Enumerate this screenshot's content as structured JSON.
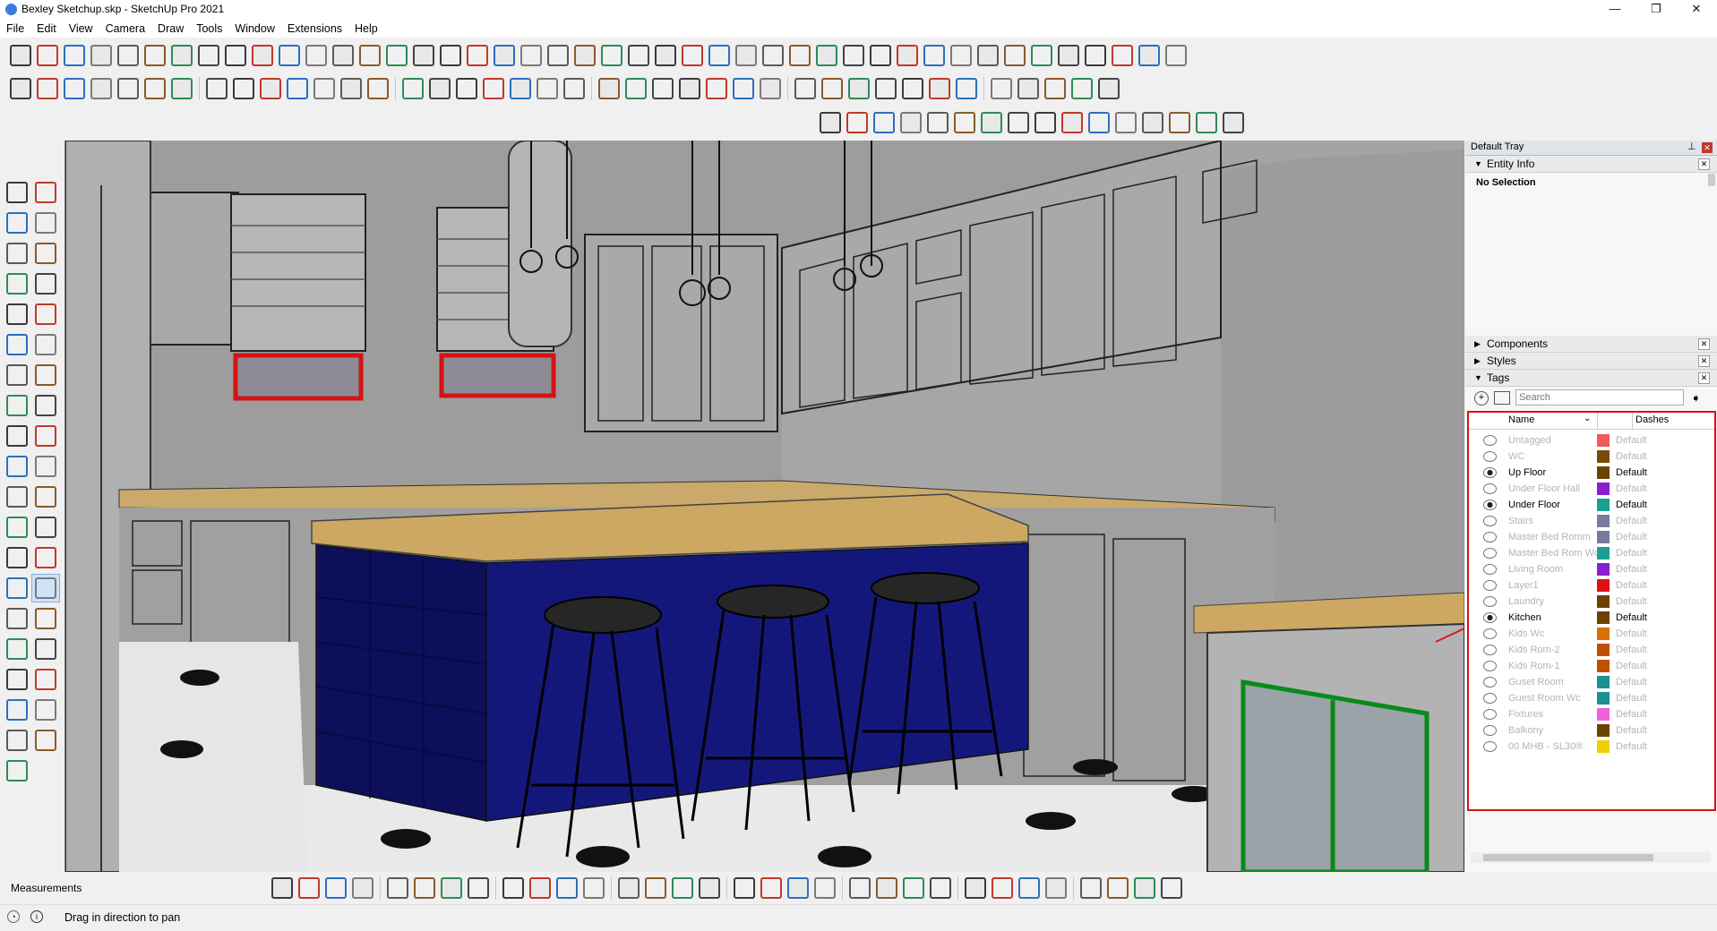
{
  "window": {
    "title": "Bexley Sketchup.skp - SketchUp Pro 2021",
    "controls": [
      "—",
      "❐",
      "✕"
    ]
  },
  "menu": [
    "File",
    "Edit",
    "View",
    "Camera",
    "Draw",
    "Tools",
    "Window",
    "Extensions",
    "Help"
  ],
  "tray": {
    "title": "Default Tray",
    "entity_info": {
      "label": "Entity Info",
      "selection": "No Selection"
    },
    "panels": [
      "Components",
      "Styles",
      "Tags"
    ],
    "tags": {
      "search_placeholder": "Search",
      "col_name": "Name",
      "col_dashes": "Dashes",
      "rows": [
        {
          "name": "Untagged",
          "color": "#f25a5a",
          "dashes": "Default",
          "visible": false
        },
        {
          "name": "WC",
          "color": "#7a4a0a",
          "dashes": "Default",
          "visible": false
        },
        {
          "name": "Up Floor",
          "color": "#6b4300",
          "dashes": "Default",
          "visible": true
        },
        {
          "name": "Under Floor Hall",
          "color": "#8a1fd0",
          "dashes": "Default",
          "visible": false
        },
        {
          "name": "Under Floor",
          "color": "#1aa08e",
          "dashes": "Default",
          "visible": true
        },
        {
          "name": "Stairs",
          "color": "#7a7a99",
          "dashes": "Default",
          "visible": false
        },
        {
          "name": "Master Bed Romm",
          "color": "#7a7a99",
          "dashes": "Default",
          "visible": false
        },
        {
          "name": "Master Bed Rom Wc",
          "color": "#1aa08e",
          "dashes": "Default",
          "visible": false
        },
        {
          "name": "Living Room",
          "color": "#8a1fd0",
          "dashes": "Default",
          "visible": false
        },
        {
          "name": "Layer1",
          "color": "#e01010",
          "dashes": "Default",
          "visible": false
        },
        {
          "name": "Laundry",
          "color": "#6b4300",
          "dashes": "Default",
          "visible": false
        },
        {
          "name": "Kitchen",
          "color": "#6b4300",
          "dashes": "Default",
          "visible": true
        },
        {
          "name": "Kids Wc",
          "color": "#d97000",
          "dashes": "Default",
          "visible": false
        },
        {
          "name": "Kids Rom-2",
          "color": "#c05000",
          "dashes": "Default",
          "visible": false
        },
        {
          "name": "Kids Rom-1",
          "color": "#c05000",
          "dashes": "Default",
          "visible": false
        },
        {
          "name": "Guset Room",
          "color": "#1a9090",
          "dashes": "Default",
          "visible": false
        },
        {
          "name": "Guest Room Wc",
          "color": "#1a9090",
          "dashes": "Default",
          "visible": false
        },
        {
          "name": "Fixtures",
          "color": "#f060e0",
          "dashes": "Default",
          "visible": false
        },
        {
          "name": "Balkony",
          "color": "#6b4300",
          "dashes": "Default",
          "visible": false
        },
        {
          "name": "00 MHB - SL30®",
          "color": "#f0d000",
          "dashes": "Default",
          "visible": false
        }
      ]
    }
  },
  "measurements_label": "Measurements",
  "status": "Drag in direction to pan",
  "accent": "#e01818"
}
